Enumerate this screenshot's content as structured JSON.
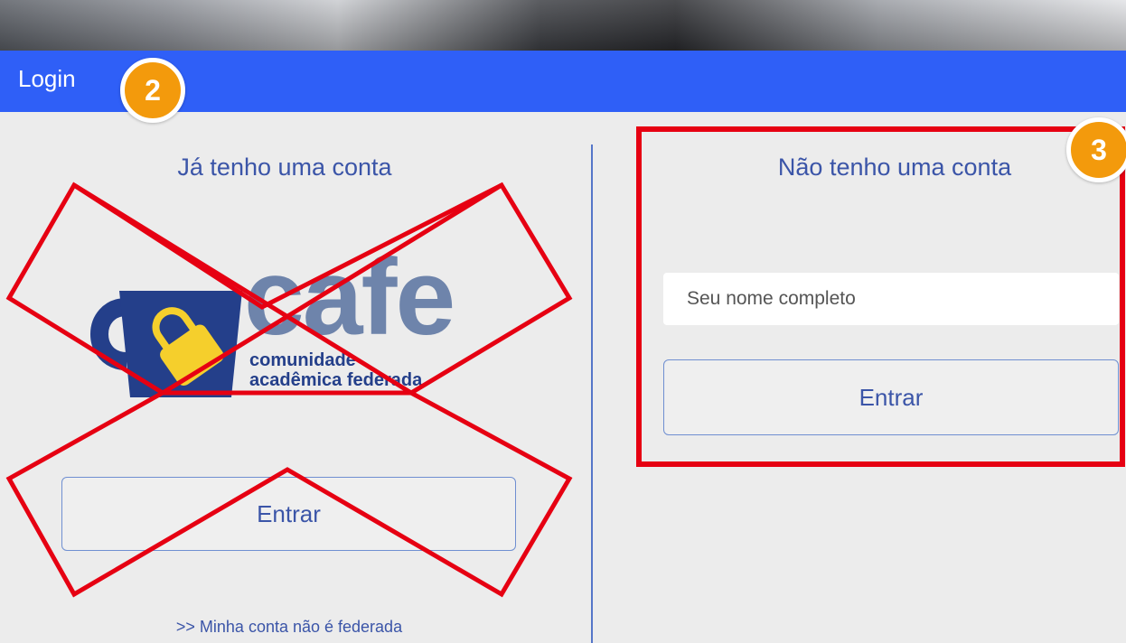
{
  "header": {
    "title": "Login",
    "color": "#2f5ff7"
  },
  "annotations": {
    "badge_left": "2",
    "badge_right": "3",
    "badge_color": "#f39a0c",
    "mark_color": "#e60012"
  },
  "left_panel": {
    "title": "Já tenho uma conta",
    "logo": {
      "name": "cafe",
      "line1": "comunidade",
      "line2": "acadêmica federada",
      "icon": "mug-lock-icon"
    },
    "button_label": "Entrar",
    "link_text": ">> Minha conta não é federada"
  },
  "right_panel": {
    "title": "Não tenho uma conta",
    "name_input": {
      "placeholder": "Seu nome completo",
      "value": ""
    },
    "button_label": "Entrar"
  }
}
